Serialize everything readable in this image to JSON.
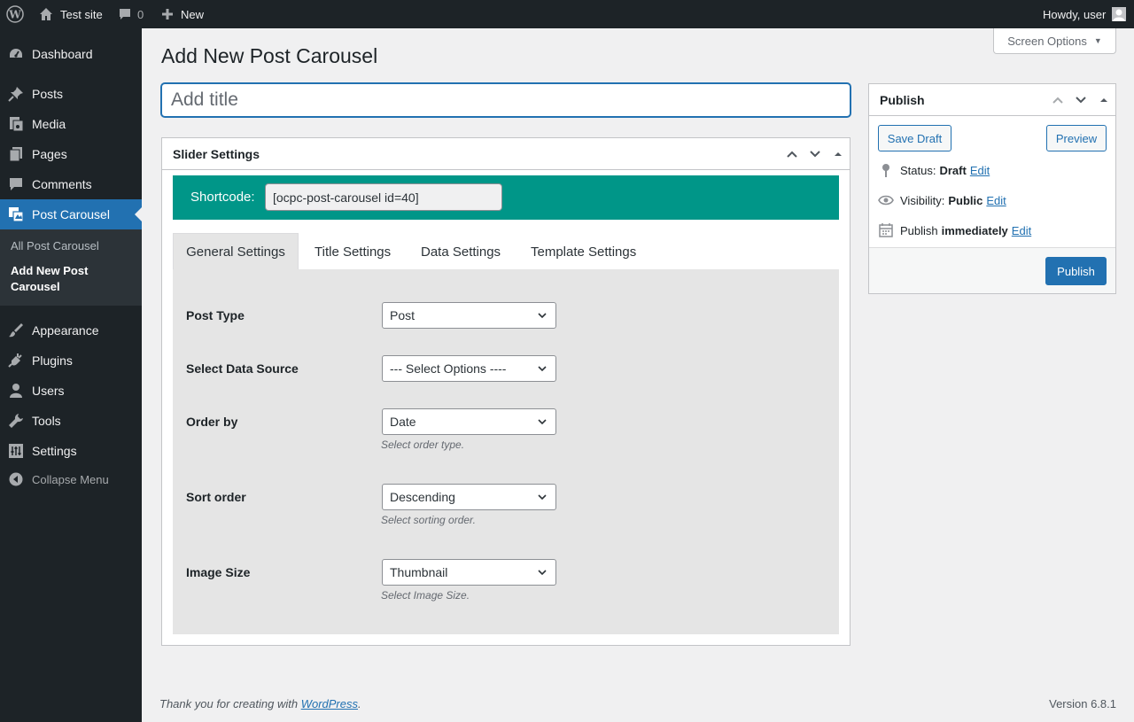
{
  "adminbar": {
    "site_name": "Test site",
    "comments_count": "0",
    "new_label": "New",
    "howdy": "Howdy, user"
  },
  "sidebar": {
    "items": [
      {
        "label": "Dashboard",
        "icon": "dashboard-icon"
      },
      {
        "label": "Posts",
        "icon": "pin-icon"
      },
      {
        "label": "Media",
        "icon": "media-icon"
      },
      {
        "label": "Pages",
        "icon": "pages-icon"
      },
      {
        "label": "Comments",
        "icon": "comment-icon"
      },
      {
        "label": "Post Carousel",
        "icon": "carousel-icon"
      },
      {
        "label": "Appearance",
        "icon": "brush-icon"
      },
      {
        "label": "Plugins",
        "icon": "plug-icon"
      },
      {
        "label": "Users",
        "icon": "user-icon"
      },
      {
        "label": "Tools",
        "icon": "wrench-icon"
      },
      {
        "label": "Settings",
        "icon": "settings-icon"
      }
    ],
    "submenu": [
      "All Post Carousel",
      "Add New Post Carousel"
    ],
    "collapse_label": "Collapse Menu"
  },
  "page": {
    "title": "Add New Post Carousel",
    "screen_options": "Screen Options",
    "title_placeholder": "Add title"
  },
  "slider": {
    "box_title": "Slider Settings",
    "shortcode_label": "Shortcode:",
    "shortcode_value": "[ocpc-post-carousel id=40]",
    "tabs": [
      "General Settings",
      "Title Settings",
      "Data Settings",
      "Template Settings"
    ],
    "fields": [
      {
        "label": "Post Type",
        "value": "Post",
        "desc": ""
      },
      {
        "label": "Select Data Source",
        "value": "--- Select Options ----",
        "desc": ""
      },
      {
        "label": "Order by",
        "value": "Date",
        "desc": "Select order type."
      },
      {
        "label": "Sort order",
        "value": "Descending",
        "desc": "Select sorting order."
      },
      {
        "label": "Image Size",
        "value": "Thumbnail",
        "desc": "Select Image Size."
      }
    ]
  },
  "publish": {
    "box_title": "Publish",
    "save_draft": "Save Draft",
    "preview": "Preview",
    "status_label": "Status:",
    "status_value": "Draft",
    "visibility_label": "Visibility:",
    "visibility_value": "Public",
    "publish_label": "Publish",
    "publish_value": "immediately",
    "edit": "Edit",
    "publish_button": "Publish"
  },
  "footer": {
    "thanks_prefix": "Thank you for creating with ",
    "thanks_link": "WordPress",
    "thanks_suffix": ".",
    "version": "Version 6.8.1"
  },
  "colors": {
    "adminbar": "#1d2327",
    "accent": "#2271b1",
    "shortcode_bar": "#009688"
  }
}
